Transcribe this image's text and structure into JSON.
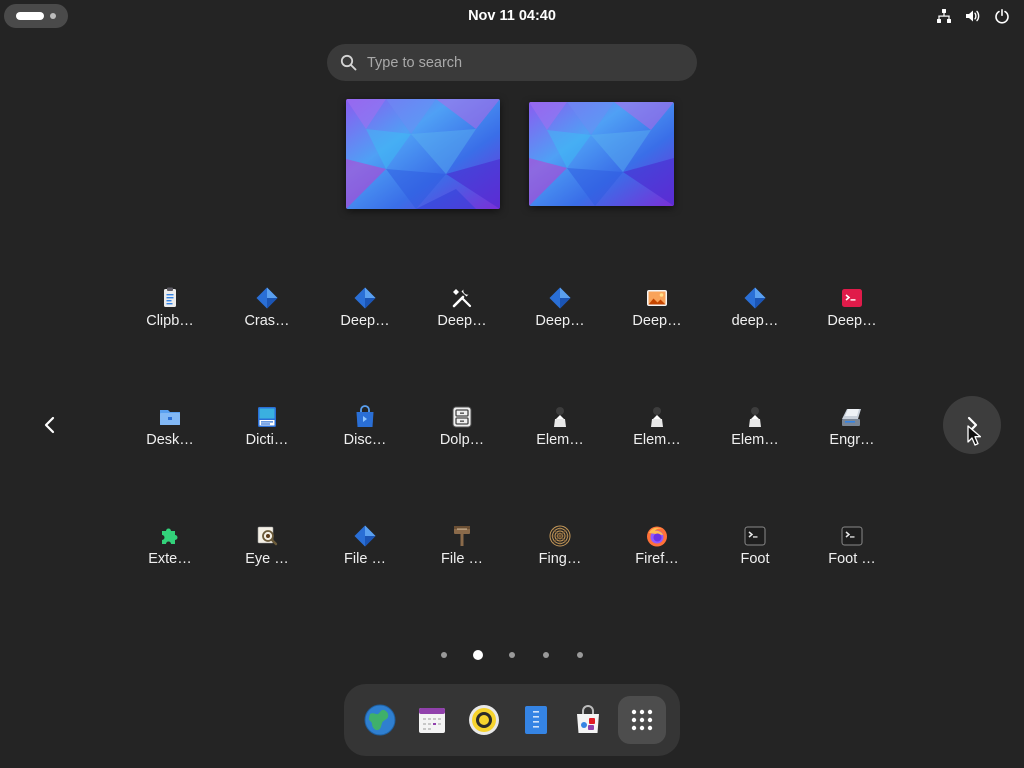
{
  "top_bar": {
    "clock": "Nov 11  04:40",
    "tray_icons": [
      "network-wired-icon",
      "volume-icon",
      "power-icon"
    ]
  },
  "search": {
    "placeholder": "Type to search",
    "value": ""
  },
  "workspaces": [
    {
      "name": "workspace-1",
      "current": true
    },
    {
      "name": "workspace-2",
      "current": false
    }
  ],
  "app_grid": {
    "rows": [
      [
        {
          "label": "Clipb…",
          "icon": "clipboard-icon"
        },
        {
          "label": "Cras…",
          "icon": "generic-app-diamond-icon"
        },
        {
          "label": "Deep…",
          "icon": "generic-app-diamond-icon"
        },
        {
          "label": "Deep…",
          "icon": "tools-icon"
        },
        {
          "label": "Deep…",
          "icon": "generic-app-diamond-icon"
        },
        {
          "label": "Deep…",
          "icon": "image-viewer-icon"
        },
        {
          "label": "deep…",
          "icon": "generic-app-diamond-icon"
        },
        {
          "label": "Deep…",
          "icon": "terminal-red-icon"
        }
      ],
      [
        {
          "label": "Desk…",
          "icon": "folder-icon"
        },
        {
          "label": "Dicti…",
          "icon": "dictionary-icon"
        },
        {
          "label": "Disc…",
          "icon": "software-bag-icon"
        },
        {
          "label": "Dolp…",
          "icon": "file-cabinet-icon"
        },
        {
          "label": "Elem…",
          "icon": "element-pawn-icon"
        },
        {
          "label": "Elem…",
          "icon": "element-pawn-icon"
        },
        {
          "label": "Elem…",
          "icon": "element-pawn-icon"
        },
        {
          "label": "Engr…",
          "icon": "scanner-icon"
        }
      ],
      [
        {
          "label": "Exte…",
          "icon": "puzzle-piece-icon"
        },
        {
          "label": "Eye …",
          "icon": "eye-of-gnome-icon"
        },
        {
          "label": "File …",
          "icon": "generic-app-diamond-icon"
        },
        {
          "label": "File …",
          "icon": "file-roller-icon"
        },
        {
          "label": "Fing…",
          "icon": "fingerprint-icon"
        },
        {
          "label": "Firef…",
          "icon": "firefox-icon"
        },
        {
          "label": "Foot",
          "icon": "terminal-icon"
        },
        {
          "label": "Foot …",
          "icon": "terminal-icon"
        }
      ]
    ]
  },
  "pagination": {
    "page_count": 5,
    "current_page": 2
  },
  "dash": {
    "items": [
      {
        "name": "web-browser",
        "icon": "globe-icon"
      },
      {
        "name": "calendar",
        "icon": "calendar-icon"
      },
      {
        "name": "music-player",
        "icon": "rhythmbox-icon"
      },
      {
        "name": "text-editor",
        "icon": "text-editor-icon"
      },
      {
        "name": "software",
        "icon": "software-store-icon"
      },
      {
        "name": "show-apps",
        "icon": "app-grid-icon"
      }
    ]
  },
  "colors": {
    "background": "#242424",
    "search_bg": "#3a3a3a",
    "dash_bg": "#353535",
    "active_dot": "#ffffff"
  }
}
